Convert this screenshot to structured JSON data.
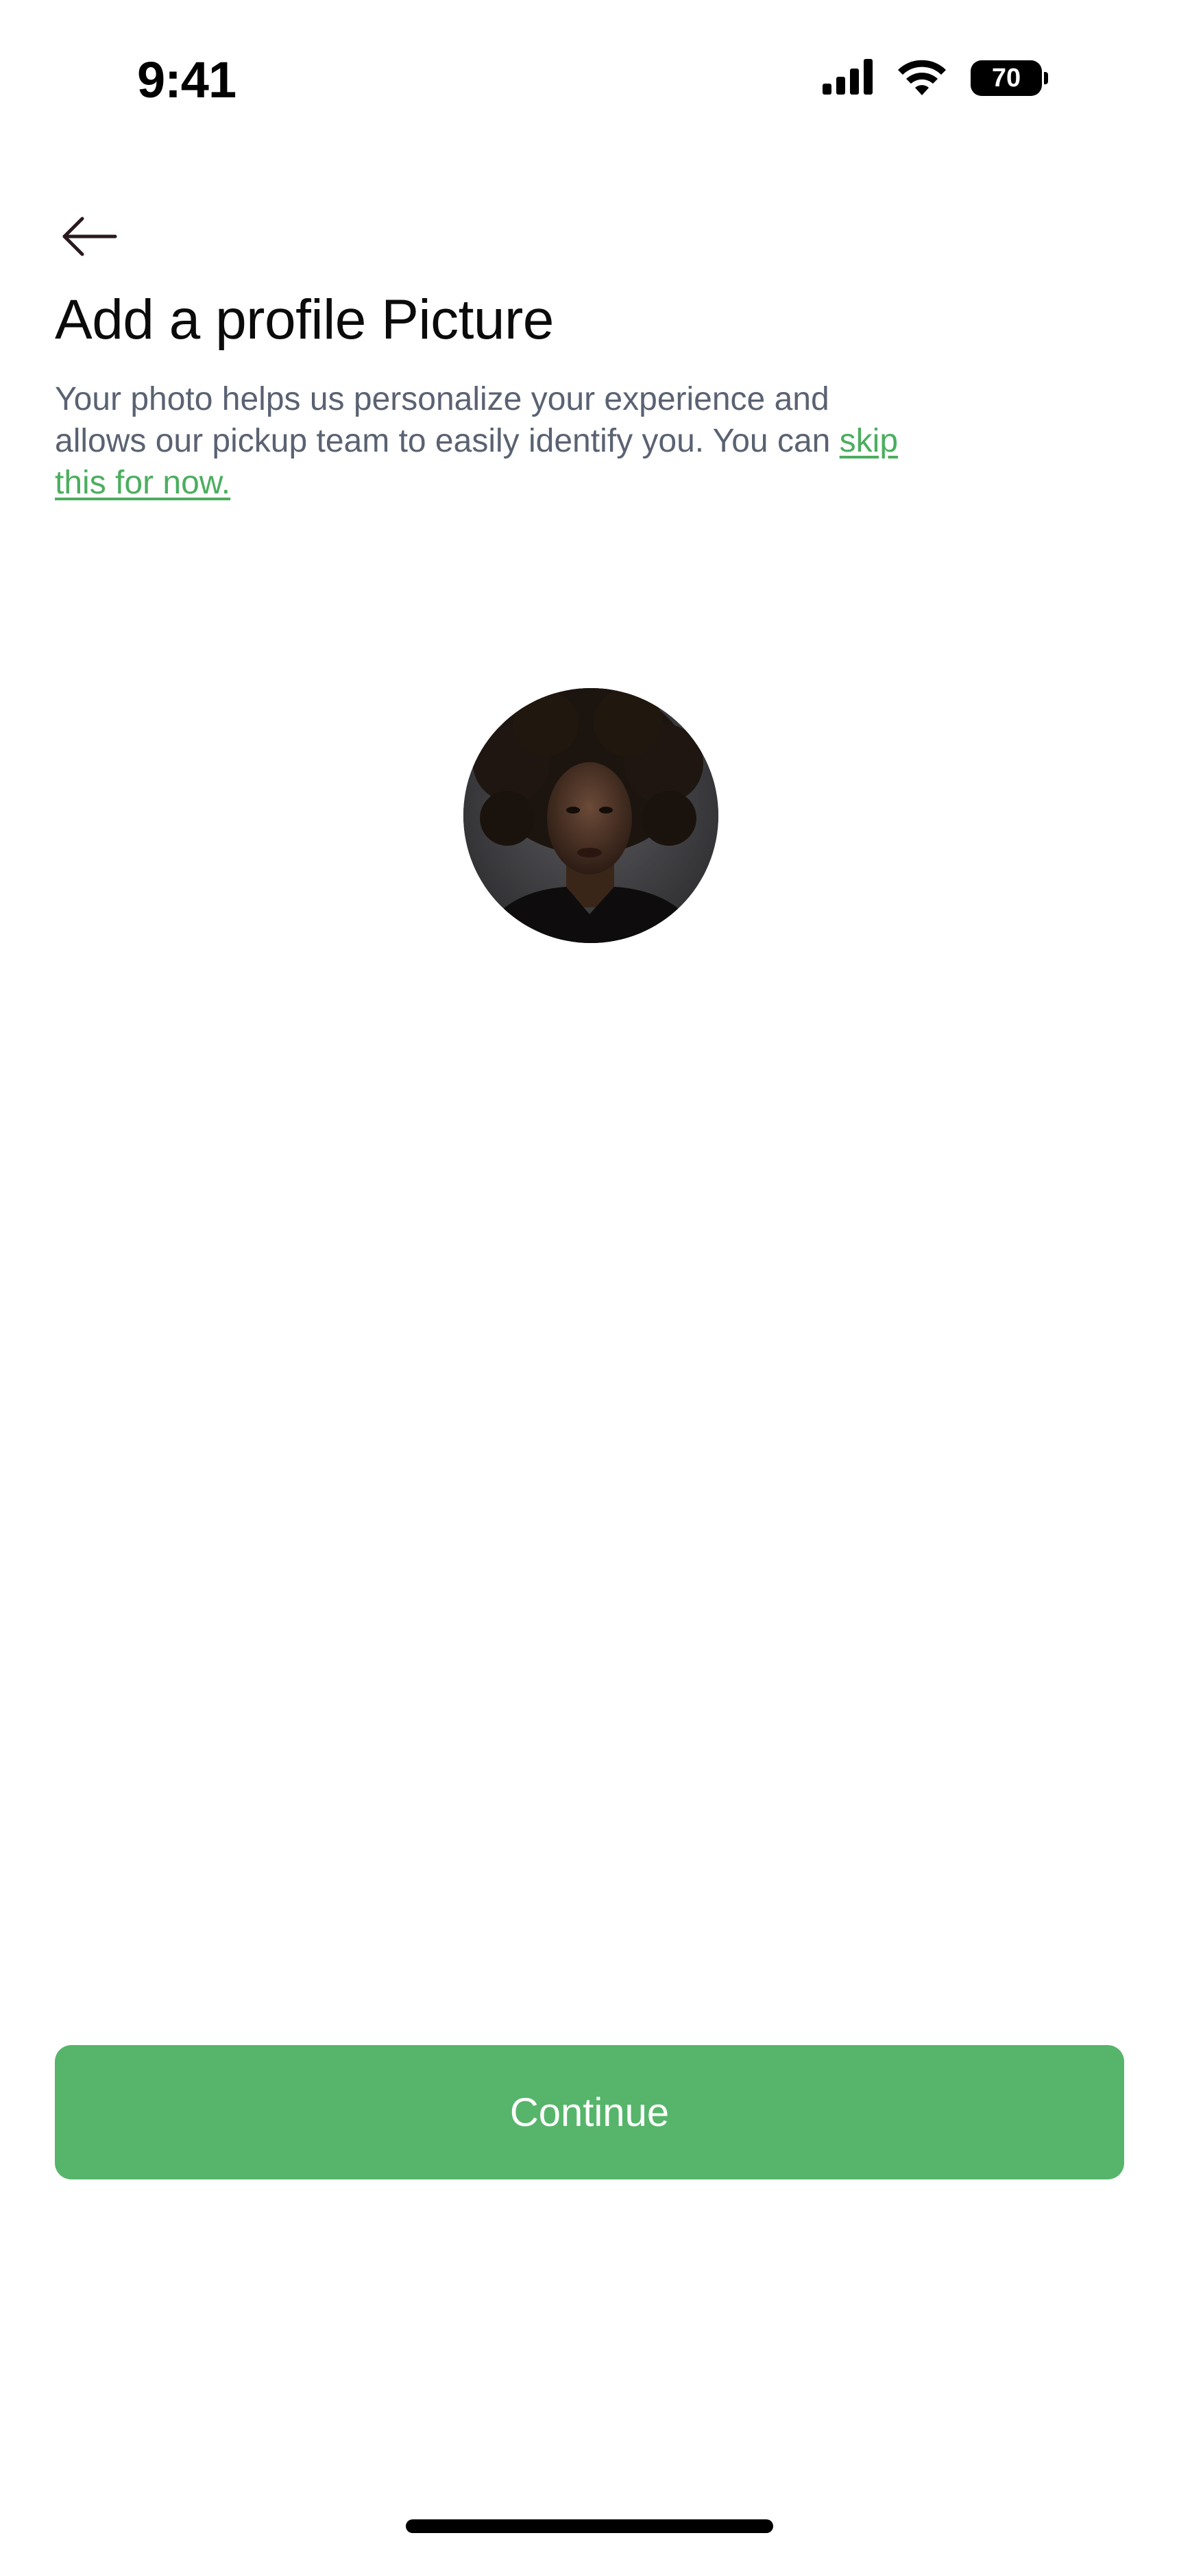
{
  "status_bar": {
    "time": "9:41",
    "battery_level": "70",
    "icons": [
      "signal-icon",
      "wifi-icon",
      "battery-icon"
    ]
  },
  "header": {
    "back_icon": "arrow-left-icon"
  },
  "main": {
    "title": "Add a profile Picture",
    "description_prefix": "Your photo helps us personalize your experience and allows our pickup team to easily identify you. You can ",
    "skip_link": "skip this for now."
  },
  "footer": {
    "continue_label": "Continue"
  },
  "colors": {
    "accent": "#56b56a",
    "link": "#4bae5f",
    "body_text": "#5a6272",
    "title": "#0b0b0b"
  }
}
